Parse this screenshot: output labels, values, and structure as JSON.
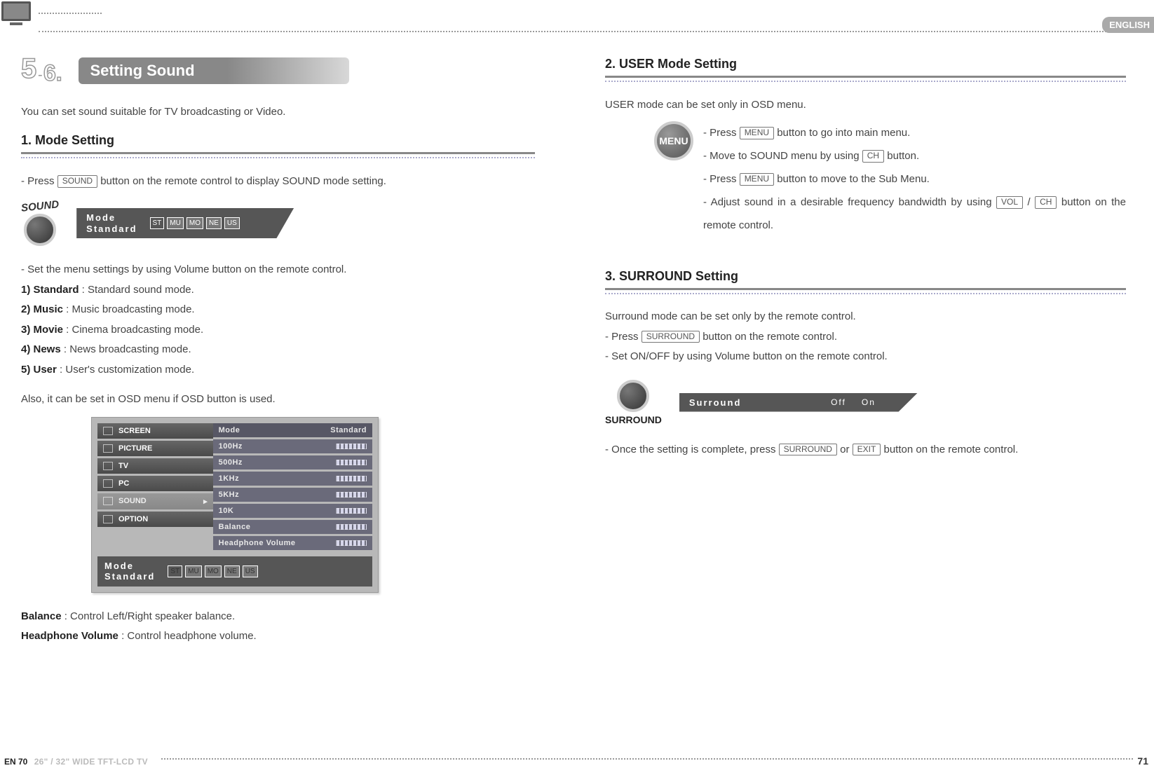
{
  "lang": "ENGLISH",
  "section_number_label": "5-6.",
  "section_title": "Setting Sound",
  "intro": "You can set sound suitable for TV broadcasting or Video.",
  "sub1": {
    "title": "1. Mode Setting",
    "line_pre": "- Press ",
    "key": "SOUND",
    "line_post": " button on the remote control to display SOUND mode setting.",
    "button_label": "SOUND",
    "osd_mode_l1": "Mode",
    "osd_mode_l2": "Standard",
    "pills": [
      "ST",
      "MU",
      "MO",
      "NE",
      "US"
    ],
    "desc_intro": "- Set the menu settings by using Volume button on the remote control.",
    "modes": [
      {
        "label": "1) Standard",
        "desc": " : Standard sound mode."
      },
      {
        "label": "2) Music",
        "desc": " : Music broadcasting mode."
      },
      {
        "label": "3) Movie",
        "desc": " : Cinema broadcasting mode."
      },
      {
        "label": "4) News",
        "desc": " : News broadcasting mode."
      },
      {
        "label": "5) User",
        "desc": " : User's customization mode."
      }
    ],
    "also": "Also, it can be set in OSD menu if OSD button is used.",
    "osd_tabs": [
      "SCREEN",
      "PICTURE",
      "TV",
      "PC",
      "SOUND",
      "OPTION"
    ],
    "osd_rows": [
      {
        "k": "Mode",
        "v": "Standard"
      },
      {
        "k": "100Hz",
        "v": ""
      },
      {
        "k": "500Hz",
        "v": ""
      },
      {
        "k": "1KHz",
        "v": ""
      },
      {
        "k": "5KHz",
        "v": ""
      },
      {
        "k": "10K",
        "v": ""
      },
      {
        "k": "Balance",
        "v": ""
      },
      {
        "k": "Headphone Volume",
        "v": ""
      }
    ],
    "balance_label": "Balance",
    "balance_desc": " : Control Left/Right speaker balance.",
    "hp_label": "Headphone Volume ",
    "hp_desc": " : Control headphone volume."
  },
  "sub2": {
    "title": "2. USER Mode Setting",
    "intro": "USER mode can be set only in OSD menu.",
    "menu_label": "MENU",
    "l1_pre": "- Press ",
    "l1_key": "MENU",
    "l1_post": " button to go into main menu.",
    "l2_pre": "- Move to SOUND menu by using ",
    "l2_key": "CH",
    "l2_post": " button.",
    "l3_pre": "- Press ",
    "l3_key": "MENU",
    "l3_post": " button to move to the Sub Menu.",
    "l4_pre": "- Adjust sound in a desirable frequency bandwidth by using ",
    "l4_key1": "VOL",
    "l4_mid": " / ",
    "l4_key2": "CH",
    "l4_post": " button on the remote control."
  },
  "sub3": {
    "title": "3. SURROUND Setting",
    "intro": "Surround mode can be set only by the remote control.",
    "l1_pre": "- Press ",
    "l1_key": "SURROUND",
    "l1_post": " button on the remote control.",
    "l2": "- Set ON/OFF by using Volume button on the remote control.",
    "button_label": "SURROUND",
    "osd_label": "Surround",
    "off": "Off",
    "on": "On",
    "complete_pre": "- Once the setting is complete, press ",
    "complete_k1": "SURROUND",
    "complete_mid": " or ",
    "complete_k2": "EXIT",
    "complete_post": " button on the remote control."
  },
  "footer": {
    "left_page": "EN 70",
    "model": "26\" / 32\" WIDE TFT-LCD TV",
    "right_page": "71"
  }
}
